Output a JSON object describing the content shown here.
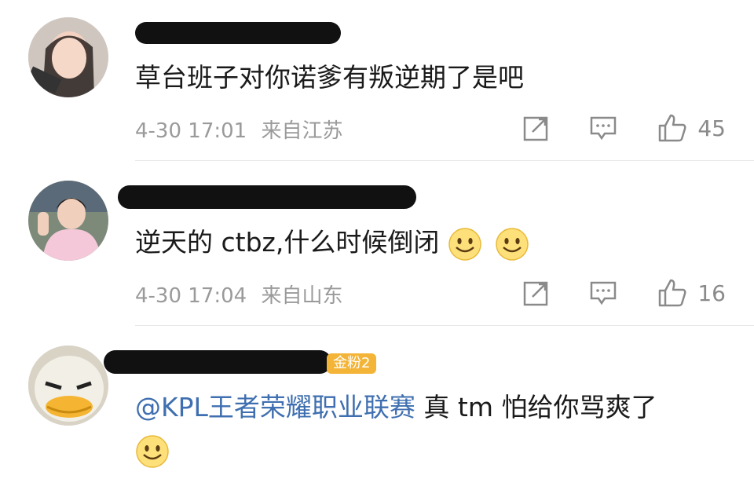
{
  "comments": [
    {
      "text": "草台班子对你诺爹有叛逆期了是吧",
      "time": "4-30 17:01",
      "location": "来自江苏",
      "likes": "45",
      "icons": [
        "share-icon",
        "comment-icon",
        "like-icon"
      ]
    },
    {
      "text": "逆天的 ctbz,什么时候倒闭",
      "time": "4-30 17:04",
      "location": "来自山东",
      "likes": "16",
      "emoji": "smile-emoji"
    },
    {
      "mention": "@KPL王者荣耀职业联赛",
      "text": " 真 tm 怕给你骂爽了",
      "badge": "金粉2",
      "emoji": "smile-emoji"
    }
  ],
  "colors": {
    "mention": "#3f6fb0",
    "meta": "#9a9a9a",
    "badge": "#f3b437"
  }
}
